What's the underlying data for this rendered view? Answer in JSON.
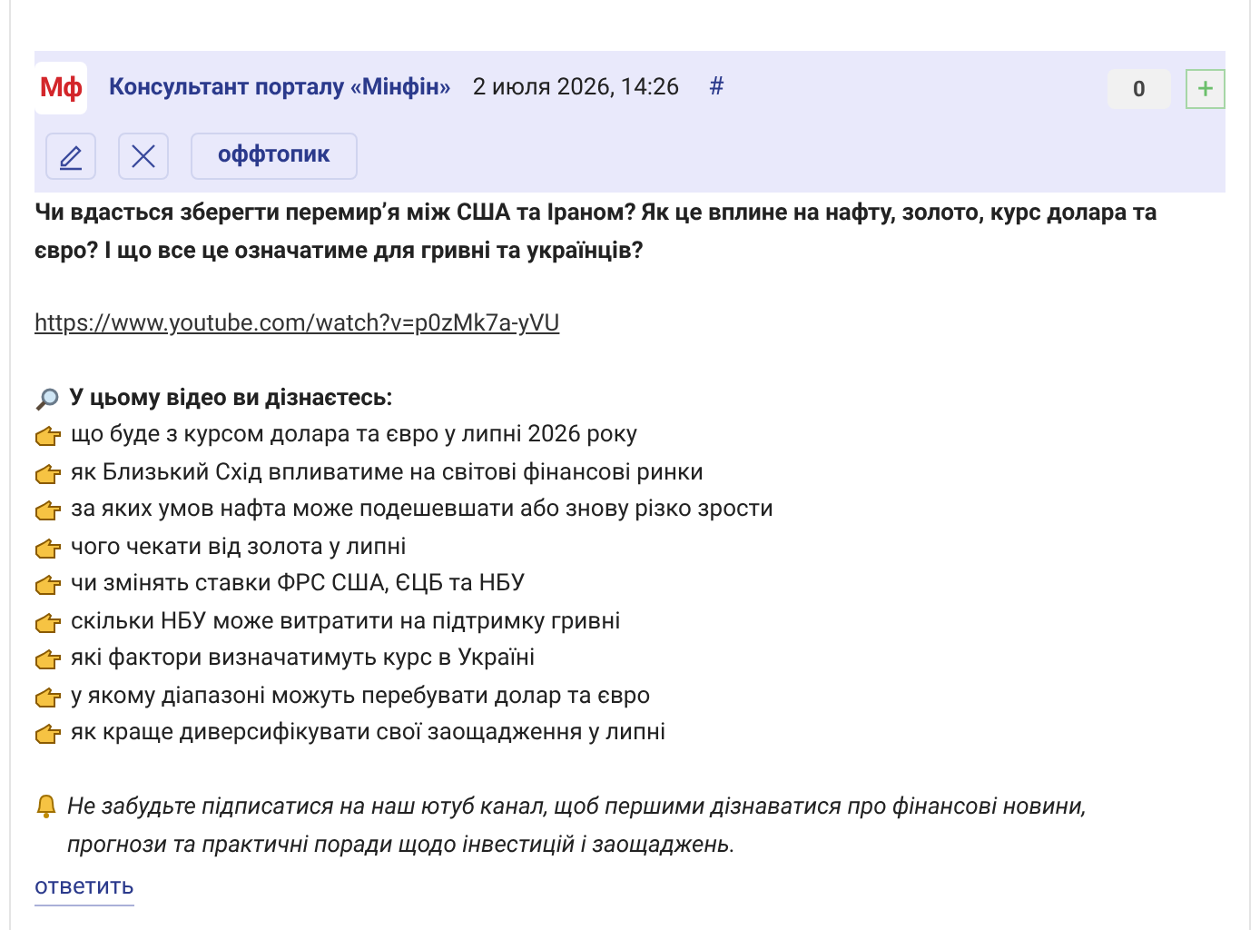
{
  "comment": {
    "avatar": "Мф",
    "author": "Консультант порталу «Мінфін»",
    "date": "2 июля 2026, 14:26",
    "permalink": "#",
    "score": "0",
    "plus": "+",
    "tag": "оффтопик",
    "intro": "Чи вдасться зберегти перемир’я між США та Іраном? Як це вплине на нафту, золото, курс долара та євро? І що все це означатиме для гривні та українців?",
    "link": "https://www.youtube.com/watch?v=p0zMk7a-yVU",
    "list_title": "У цьому відео ви дізнаєтесь:",
    "points": [
      "що буде з курсом долара та євро у липні 2026 року",
      "як Близький Схід впливатиме на світові фінансові ринки",
      "за яких умов нафта може подешевшати або знову різко зрости",
      "чого чекати від золота у липні",
      "чи змінять ставки ФРС США, ЄЦБ та НБУ",
      "скільки НБУ може витратити на підтримку гривні",
      "які фактори визначатимуть курс в Україні",
      "у якому діапазоні можуть перебувати долар та євро",
      "як краще диверсифікувати свої заощадження у липні"
    ],
    "reminder": "Не забудьте підписатися на наш ютуб канал, щоб першими дізнаватися про фінансові новини, прогнози та практичні поради щодо інвестицій і заощаджень.",
    "reply": "ответить"
  }
}
